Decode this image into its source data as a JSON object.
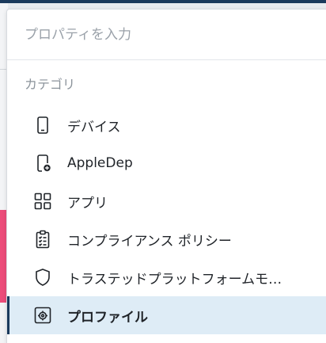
{
  "search": {
    "placeholder": "プロパティを入力"
  },
  "category_heading": "カテゴリ",
  "items": [
    {
      "label": "デバイス",
      "icon": "device-phone-icon"
    },
    {
      "label": "AppleDep",
      "icon": "apple-device-add-icon"
    },
    {
      "label": "アプリ",
      "icon": "apps-grid-icon"
    },
    {
      "label": "コンプライアンス ポリシー",
      "icon": "clipboard-checklist-icon"
    },
    {
      "label": "トラステッドプラットフォームモ…",
      "icon": "shield-icon"
    },
    {
      "label": "プロファイル",
      "icon": "profile-settings-icon",
      "selected": true
    }
  ],
  "colors": {
    "accent": "#1b3a5c",
    "selected_bg": "#deecf6",
    "muted_text": "#8b939b"
  }
}
